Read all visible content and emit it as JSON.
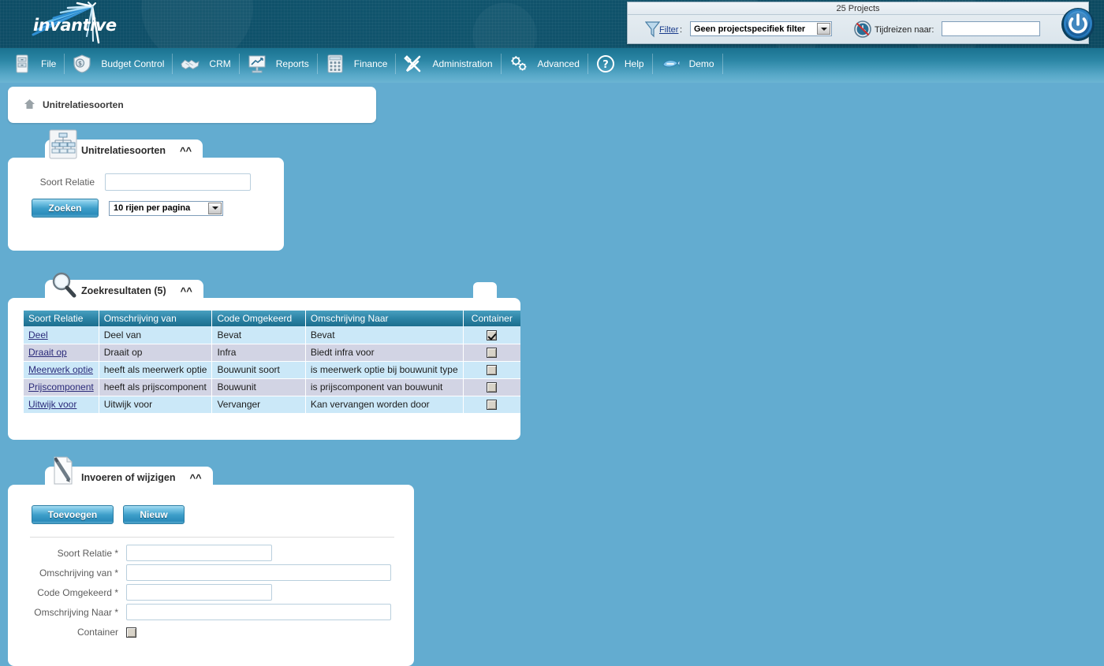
{
  "app": {
    "brand": "invantive",
    "logo_icon": "invantive-starburst-logo"
  },
  "filter_bar": {
    "title": "25 Projects",
    "funnel_icon": "funnel-filter-icon",
    "filter_link": "Filter",
    "colon": ":",
    "filter_value": "Geen projectspecifiek filter",
    "clock_icon": "time-travel-clock-icon",
    "time_travel_label": "Tijdreizen naar:",
    "time_travel_value": "",
    "power_icon": "power-logout-icon"
  },
  "menu": {
    "items": [
      {
        "label": "File",
        "icon": "file-cabinet-icon"
      },
      {
        "label": "Budget Control",
        "icon": "money-shield-icon"
      },
      {
        "label": "CRM",
        "icon": "handshake-icon"
      },
      {
        "label": "Reports",
        "icon": "presentation-chart-icon"
      },
      {
        "label": "Finance",
        "icon": "calculator-icon"
      },
      {
        "label": "Administration",
        "icon": "tools-wrench-screwdriver-icon"
      },
      {
        "label": "Advanced",
        "icon": "gears-icon"
      },
      {
        "label": "Help",
        "icon": "question-mark-circle-icon"
      },
      {
        "label": "Demo",
        "icon": "invantive-fish-icon"
      }
    ]
  },
  "breadcrumb": {
    "home_icon": "home-icon",
    "text": "Unitrelatiesoorten"
  },
  "search_panel": {
    "tab_icon": "org-chart-icon",
    "title": "Unitrelatiesoorten",
    "collapse_icon": "chevron-up-icon",
    "field_label": "Soort Relatie",
    "field_value": "",
    "search_button": "Zoeken",
    "rows_per_page": "10 rijen per pagina"
  },
  "results_panel": {
    "tab_icon": "magnifier-icon",
    "title": "Zoekresultaten (5)",
    "collapse_icon": "chevron-up-icon",
    "columns": [
      "Soort Relatie",
      "Omschrijving van",
      "Code Omgekeerd",
      "Omschrijving Naar",
      "Container"
    ],
    "rows": [
      {
        "soort_relatie": "Deel",
        "omschrijving_van": "Deel van",
        "code_omgekeerd": "Bevat",
        "omschrijving_naar": "Bevat",
        "container": true
      },
      {
        "soort_relatie": "Draait op",
        "omschrijving_van": "Draait op",
        "code_omgekeerd": "Infra",
        "omschrijving_naar": "Biedt infra voor",
        "container": false
      },
      {
        "soort_relatie": "Meerwerk optie",
        "omschrijving_van": "heeft als meerwerk optie",
        "code_omgekeerd": "Bouwunit soort",
        "omschrijving_naar": "is meerwerk optie bij bouwunit type",
        "container": false
      },
      {
        "soort_relatie": "Prijscomponent",
        "omschrijving_van": "heeft als prijscomponent",
        "code_omgekeerd": "Bouwunit",
        "omschrijving_naar": "is prijscomponent van bouwunit",
        "container": false
      },
      {
        "soort_relatie": "Uitwijk voor",
        "omschrijving_van": "Uitwijk voor",
        "code_omgekeerd": "Vervanger",
        "omschrijving_naar": "Kan vervangen worden door",
        "container": false
      }
    ]
  },
  "entry_panel": {
    "tab_icon": "document-pencil-icon",
    "title": "Invoeren of wijzigen",
    "collapse_icon": "chevron-up-icon",
    "add_button": "Toevoegen",
    "new_button": "Nieuw",
    "fields": [
      {
        "label": "Soort Relatie *",
        "value": ""
      },
      {
        "label": "Omschrijving van *",
        "value": ""
      },
      {
        "label": "Code Omgekeerd *",
        "value": ""
      },
      {
        "label": "Omschrijving Naar *",
        "value": ""
      }
    ],
    "checkbox_label": "Container",
    "checkbox_checked": false
  },
  "colors": {
    "page_background": "#63acd0",
    "banner_dark": "#0e4d66",
    "menu_top": "#1a7290",
    "menu_bottom": "#6cb5d3",
    "grid_header_top": "#49a0c0",
    "grid_header_bottom": "#1d6e8e",
    "row_odd": "#cbe8f8",
    "row_even": "#d2d4e4",
    "link": "#2b2b7a"
  }
}
